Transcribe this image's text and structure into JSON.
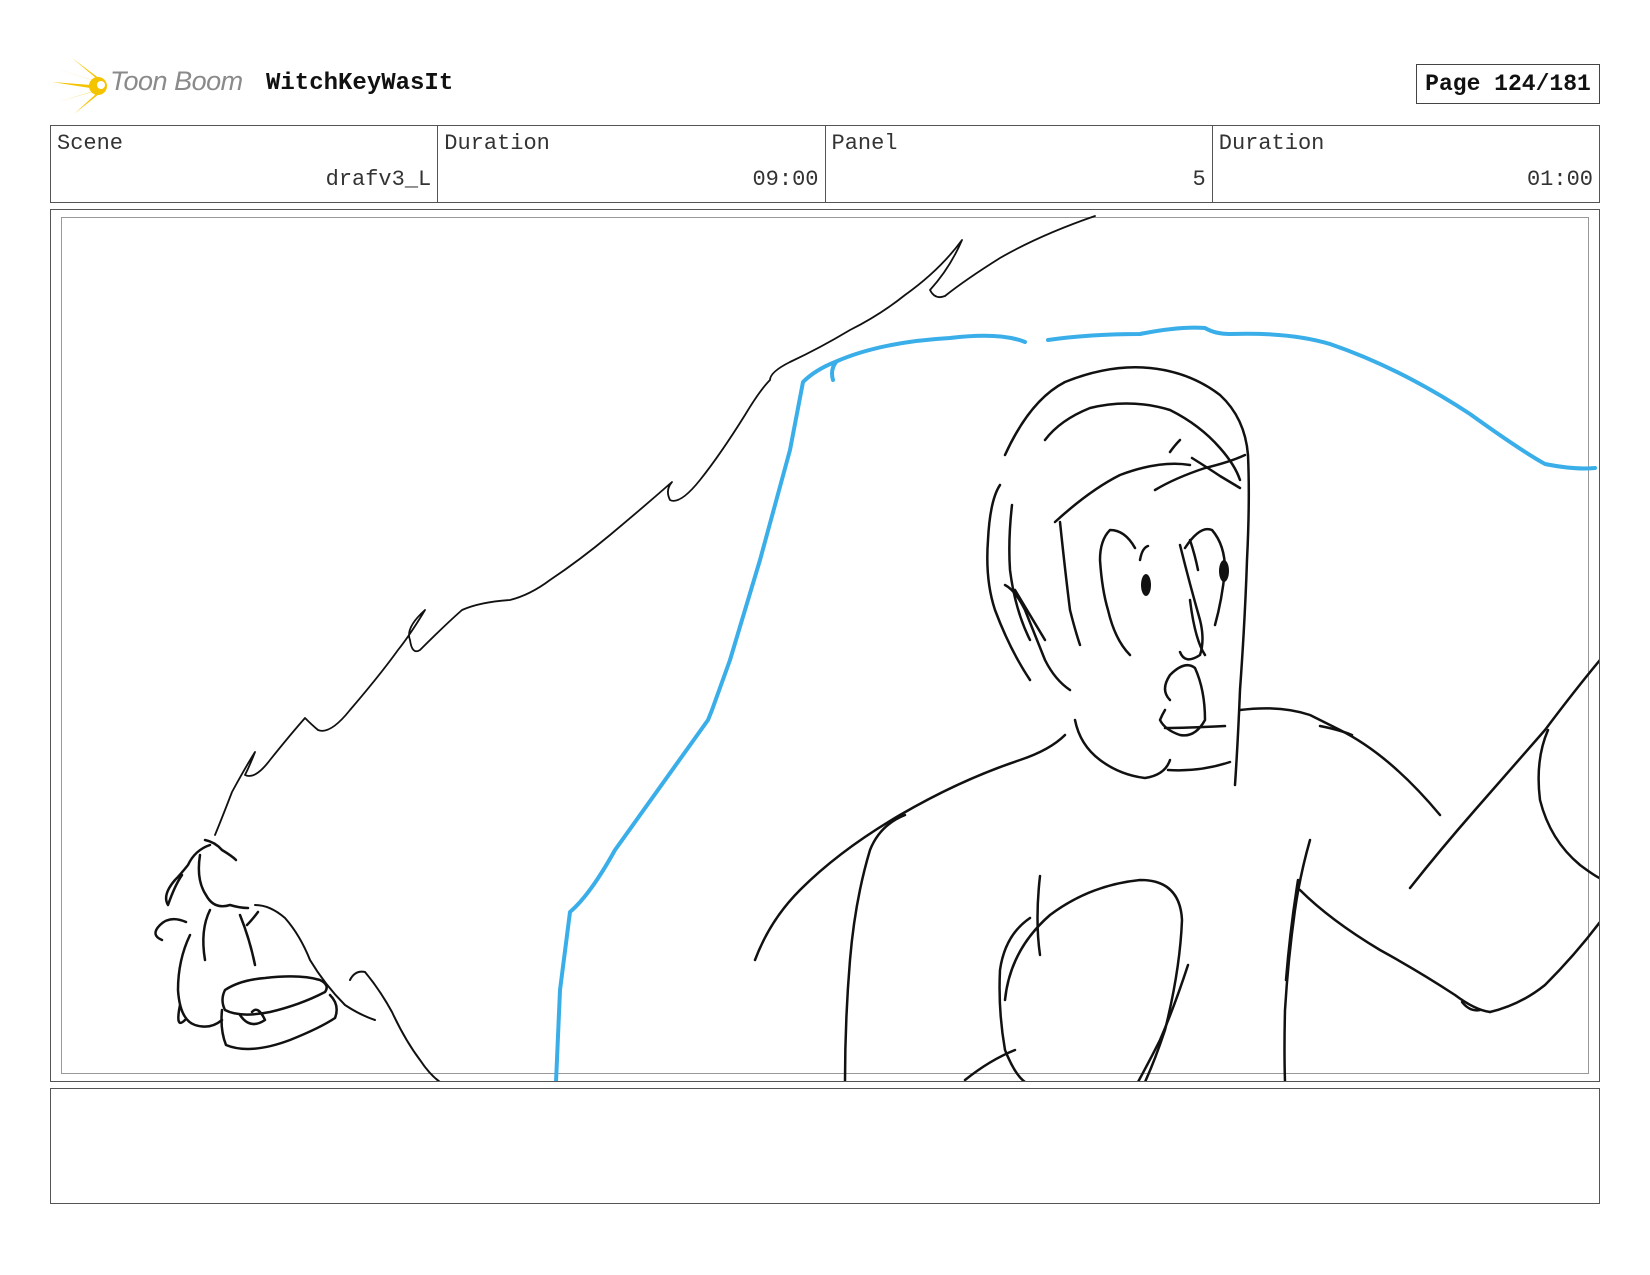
{
  "header": {
    "logo_text": "Toon Boom",
    "project_title": "WitchKeyWasIt",
    "page_label": "Page 124/181"
  },
  "info": {
    "scene_label": "Scene",
    "scene_value": "drafv3_L",
    "scene_duration_label": "Duration",
    "scene_duration_value": "09:00",
    "panel_label": "Panel",
    "panel_value": "5",
    "panel_duration_label": "Duration",
    "panel_duration_value": "01:00"
  },
  "colors": {
    "logo_yellow": "#f5c400",
    "sketch_blue": "#3aaee8",
    "sketch_black": "#111111"
  },
  "notes": {
    "text": ""
  }
}
